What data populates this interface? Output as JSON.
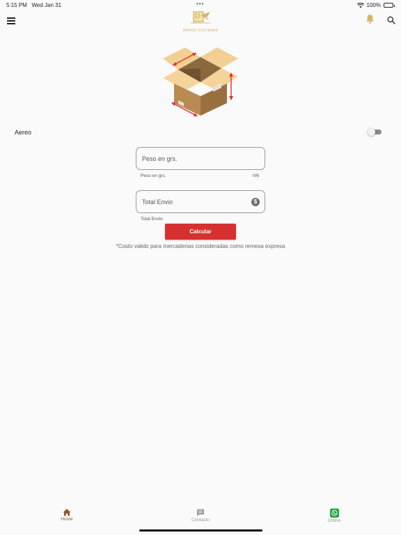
{
  "status_bar": {
    "time": "5:15 PM",
    "date": "Wed Jan 31",
    "battery": "100%"
  },
  "header": {
    "logo_text": "BRINS COURIER",
    "icons": [
      "menu-icon",
      "bell-icon",
      "search-icon"
    ]
  },
  "shipping": {
    "aereo_label": "Aereo",
    "aereo_enabled": false,
    "peso": {
      "placeholder": "Peso en grs.",
      "helper": "Peso en grs.",
      "counter": "0/6"
    },
    "total": {
      "placeholder": "Total Envio",
      "helper": "Total Envio"
    },
    "calculate_label": "Calcular",
    "note": "*Costo valido para mercaderias consideradas como remesa expresa"
  },
  "bottom_nav": {
    "items": [
      {
        "label": "Home",
        "icon": "home-icon",
        "active": true
      },
      {
        "label": "Contacto",
        "icon": "chat-icon",
        "active": false
      },
      {
        "label": "Online",
        "icon": "whatsapp-icon",
        "active": false
      }
    ]
  },
  "colors": {
    "accent": "#d63031",
    "gold": "#c9a04a",
    "home_active": "#8b5a2b",
    "whatsapp": "#25a244"
  }
}
